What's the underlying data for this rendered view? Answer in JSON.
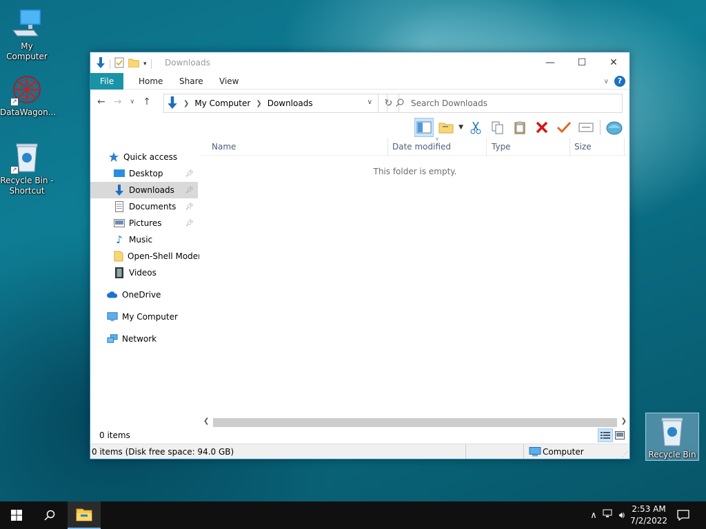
{
  "desktop": {
    "icons": [
      {
        "label": "My Computer"
      },
      {
        "label": "DataWagon..."
      },
      {
        "label": "Recycle Bin - Shortcut"
      },
      {
        "label": "Recycle Bin"
      }
    ]
  },
  "window": {
    "title": "Downloads",
    "ribbon_tabs": [
      "File",
      "Home",
      "Share",
      "View"
    ],
    "address": {
      "crumbs": [
        "My Computer",
        "Downloads"
      ]
    },
    "search": {
      "placeholder": "Search Downloads"
    },
    "help_label": "?"
  },
  "sidebar": {
    "items": [
      {
        "label": "Quick access",
        "icon": "star-icon"
      },
      {
        "label": "Desktop",
        "icon": "desktop-icon",
        "pinned": true
      },
      {
        "label": "Downloads",
        "icon": "download-arrow-icon",
        "pinned": true,
        "selected": true
      },
      {
        "label": "Documents",
        "icon": "documents-icon",
        "pinned": true
      },
      {
        "label": "Pictures",
        "icon": "pictures-icon",
        "pinned": true
      },
      {
        "label": "Music",
        "icon": "music-icon"
      },
      {
        "label": "Open-Shell Modern",
        "icon": "folder-icon"
      },
      {
        "label": "Videos",
        "icon": "videos-icon"
      },
      {
        "label": "OneDrive",
        "icon": "cloud-icon"
      },
      {
        "label": "My Computer",
        "icon": "computer-icon"
      },
      {
        "label": "Network",
        "icon": "network-icon"
      }
    ]
  },
  "filelist": {
    "columns": [
      "Name",
      "Date modified",
      "Type",
      "Size"
    ],
    "empty_message": "This folder is empty."
  },
  "status": {
    "item_count": "0 items",
    "disk_info": "0 items (Disk free space: 94.0 GB)",
    "location": "Computer"
  },
  "taskbar": {
    "time": "2:53 AM",
    "date": "7/2/2022"
  },
  "colors": {
    "file_tab": "#1a93a7",
    "accent_blue": "#1a6fc1",
    "window_border": "#2a86c8"
  }
}
